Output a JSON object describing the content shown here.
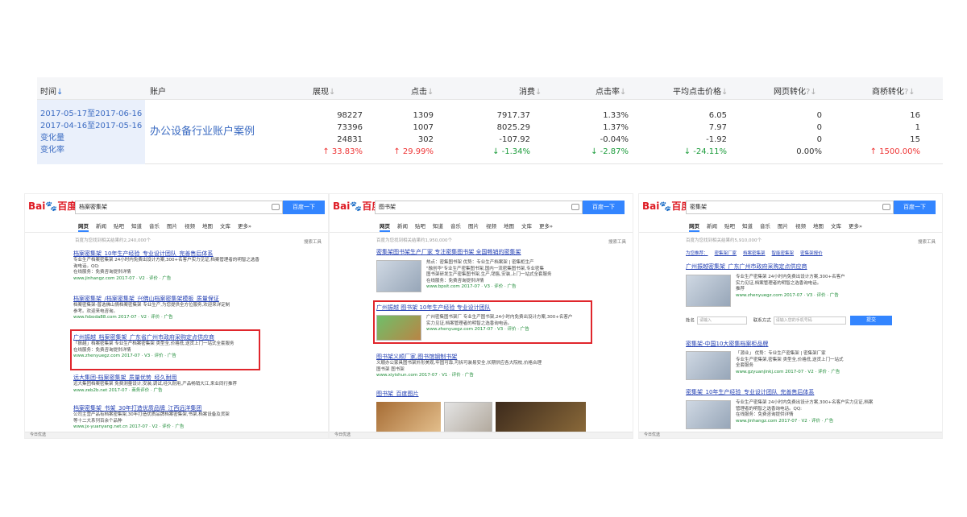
{
  "stats": {
    "headers": [
      "时间",
      "账户",
      "展现",
      "点击",
      "消费",
      "点击率",
      "平均点击价格",
      "网页转化",
      "商桥转化"
    ],
    "header_marks": [
      "↓",
      "",
      "↓",
      "↓",
      "↓",
      "↓",
      "↓",
      "?↓",
      "?↓"
    ],
    "date_rows": [
      "2017-05-17至2017-06-16",
      "2017-04-16至2017-05-16",
      "变化量",
      "变化率"
    ],
    "account": "办公设备行业账户案例",
    "rows": [
      [
        "98227",
        "1309",
        "7917.37",
        "1.33%",
        "6.05",
        "0",
        "16"
      ],
      [
        "73396",
        "1007",
        "8025.29",
        "1.37%",
        "7.97",
        "0",
        "1"
      ],
      [
        "24831",
        "302",
        "-107.92",
        "-0.04%",
        "-1.92",
        "0",
        "15"
      ],
      [
        "↑ 33.83%",
        "↑ 29.99%",
        "↓ -1.34%",
        "↓ -2.87%",
        "↓ -24.11%",
        "0.00%",
        "↑ 1500.00%"
      ]
    ]
  },
  "panels": [
    {
      "query": "档案密集架",
      "button": "百度一下",
      "tabs": [
        "网页",
        "新闻",
        "贴吧",
        "知道",
        "音乐",
        "图片",
        "视频",
        "地图",
        "文库",
        "更多»"
      ],
      "count": "百度为您找到相关结果约2,240,000个",
      "tool": "搜索工具",
      "results": [
        {
          "title": "档案密集架_10年生产经验_专业设计团队_完善售后体系",
          "desc": [
            "专业生产档案密集架 24小时内免费出设计方案,300+名客户实力见证,档案管理者的明智之选香",
            "询电话。QQ:",
            "在线服务：免费咨询提供详情"
          ],
          "url": "www.jinhangz.com 2017-07 · V2 · 评价 · 广告"
        },
        {
          "title": "档案密集架_/档案密集架_兴佛山档案密集架模板_质量保证",
          "desc": [
            "档案密集架-普选佛山情档案密集架 专业生产,为您提供全方位服务,欢迎来详定制",
            "参考。欢迎来电咨询。"
          ],
          "url": "www.fsboda88.com 2017-07 · V2 · 评价 · 广告"
        },
        {
          "title": "广州振越_档案密集架_广东省广州市政府采购定点供应商",
          "desc": [
            "「振越」档案密集架 专业生产档案密集架 类型全,价格低,送货上门一站式全套服务",
            "在线服务：免费咨询提供详情"
          ],
          "url": "www.zhenyuegz.com 2017-07 · V3 · 评价 · 广告"
        },
        {
          "title": "远大集团-档案密集架_质量优势_经久耐用",
          "desc": [
            "远大集团档案密集架 免费测量设计,安装,调试,经久耐用,产品畅销大江,来业同行推荐"
          ],
          "url": "www.zeb2b.net 2017-07 · 商务评价 · 广告"
        },
        {
          "title": "档案密集架_书架_30年打造优质品牌_江西远洋集团",
          "desc": [
            "公司主营产品有档案密集架,30年打造优质品牌档案密集架,书架,档案设备及货架",
            "等十二大系列百余个品种"
          ],
          "url": "www.jx-yuanyang.net.cn 2017-07 · V2 · 评价 · 广告"
        }
      ],
      "bottom": "今日优选"
    },
    {
      "query": "图书架",
      "button": "百度一下",
      "tabs": [
        "网页",
        "新闻",
        "贴吧",
        "知道",
        "音乐",
        "图片",
        "视频",
        "地图",
        "文库",
        "更多»"
      ],
      "count": "百度为您找到相关结果约1,950,000个",
      "tool": "搜索工具",
      "results": [
        {
          "title": "密集架图书架生产厂家 专注密集图书架 全国畅销的密集架",
          "desc": [
            "热点：密集图书架    优势：专业生产档案架 | 密集柜生产",
            "\"融创华\"专业生产密集图书架,国内一流密集图书架,专业密集",
            "图书架研发生产密集图书架,生产,销售,安装,上门一站式全套服务",
            "在线服务：免费咨询提供详情"
          ],
          "url": "www.bpsit.com 2017-07 · V3 · 评价 · 广告"
        },
        {
          "title": "广州振越 图书架 10年生产经验 专业设计团队",
          "desc": [
            "广州密集图书架厂 专业生产图书架,24小时内免费出设计方案,300+名客户",
            "实力见证,档案管理者的明智之选香询电话。"
          ],
          "url": "www.zhenyuegz.com 2017-07 · V3 · 评价 · 广告"
        },
        {
          "title": "图书架义顺厂家,图书馆钢制书架",
          "desc": [
            "义顺办公家具图书架外形美观,牢固可靠,可拆可装易安全,长期供应各大院校,价格合理",
            "图书架 图书架"
          ],
          "url": "www.xiyishun.com 2017-07 · V1 · 评价 · 广告"
        },
        {
          "title": "图书架_百度图片",
          "desc": [],
          "url": ""
        }
      ],
      "bottom": "今日优选"
    },
    {
      "query": "密集架",
      "button": "百度一下",
      "tabs": [
        "网页",
        "新闻",
        "贴吧",
        "知道",
        "音乐",
        "图片",
        "视频",
        "地图",
        "文库",
        "更多»"
      ],
      "count": "百度为您找到相关结果约5,910,000个",
      "tool": "搜索工具",
      "subtabs": [
        "为您推荐：",
        "密集架厂家",
        "档案密集架",
        "智能密集架",
        "密集架报价"
      ],
      "results": [
        {
          "title": "广州振越密集架_广东广州市政府采购定点供应商",
          "desc": [
            "专业生产密集架 24小时内免费出设计方案,300+名客户",
            "实力见证,档案管理者的明智之选香询电话。",
            "推荐"
          ],
          "url": "www.zhenyuegz.com 2017-07 · V3 · 评价 · 广告"
        },
        {
          "title": "密集架-中国10大密集档案柜品牌",
          "desc": [
            "「源业」    优势：专业生产密集架 | 密集架厂家",
            "专业生产密集架,密集架 类型全,价格低,送货上门一站式",
            "全套服务"
          ],
          "url": "www.gzyuanjinkj.com 2017-07 · V2 · 评价 · 广告"
        },
        {
          "title": "密集架_10年生产经验_专业设计团队_完善售后体系",
          "desc": [
            "专业生产密集架 24小时内免费出设计方案,300+名客户实力见证,档案",
            "管理者的明智之选香询电话。QQ:",
            "在线服务：免费咨询提供详情"
          ],
          "url": "www.jinhangz.com 2017-07 · V2 · 评价 · 广告"
        }
      ],
      "form": {
        "name_label": "姓名",
        "name_placeholder": "请输入",
        "contact_label": "联系方式",
        "contact_placeholder": "请输入您的手机号码",
        "submit": "提交"
      },
      "bottom": "今日优选"
    }
  ],
  "logo": {
    "bai": "Bai",
    "du": "百度",
    "paw": "🐾"
  }
}
